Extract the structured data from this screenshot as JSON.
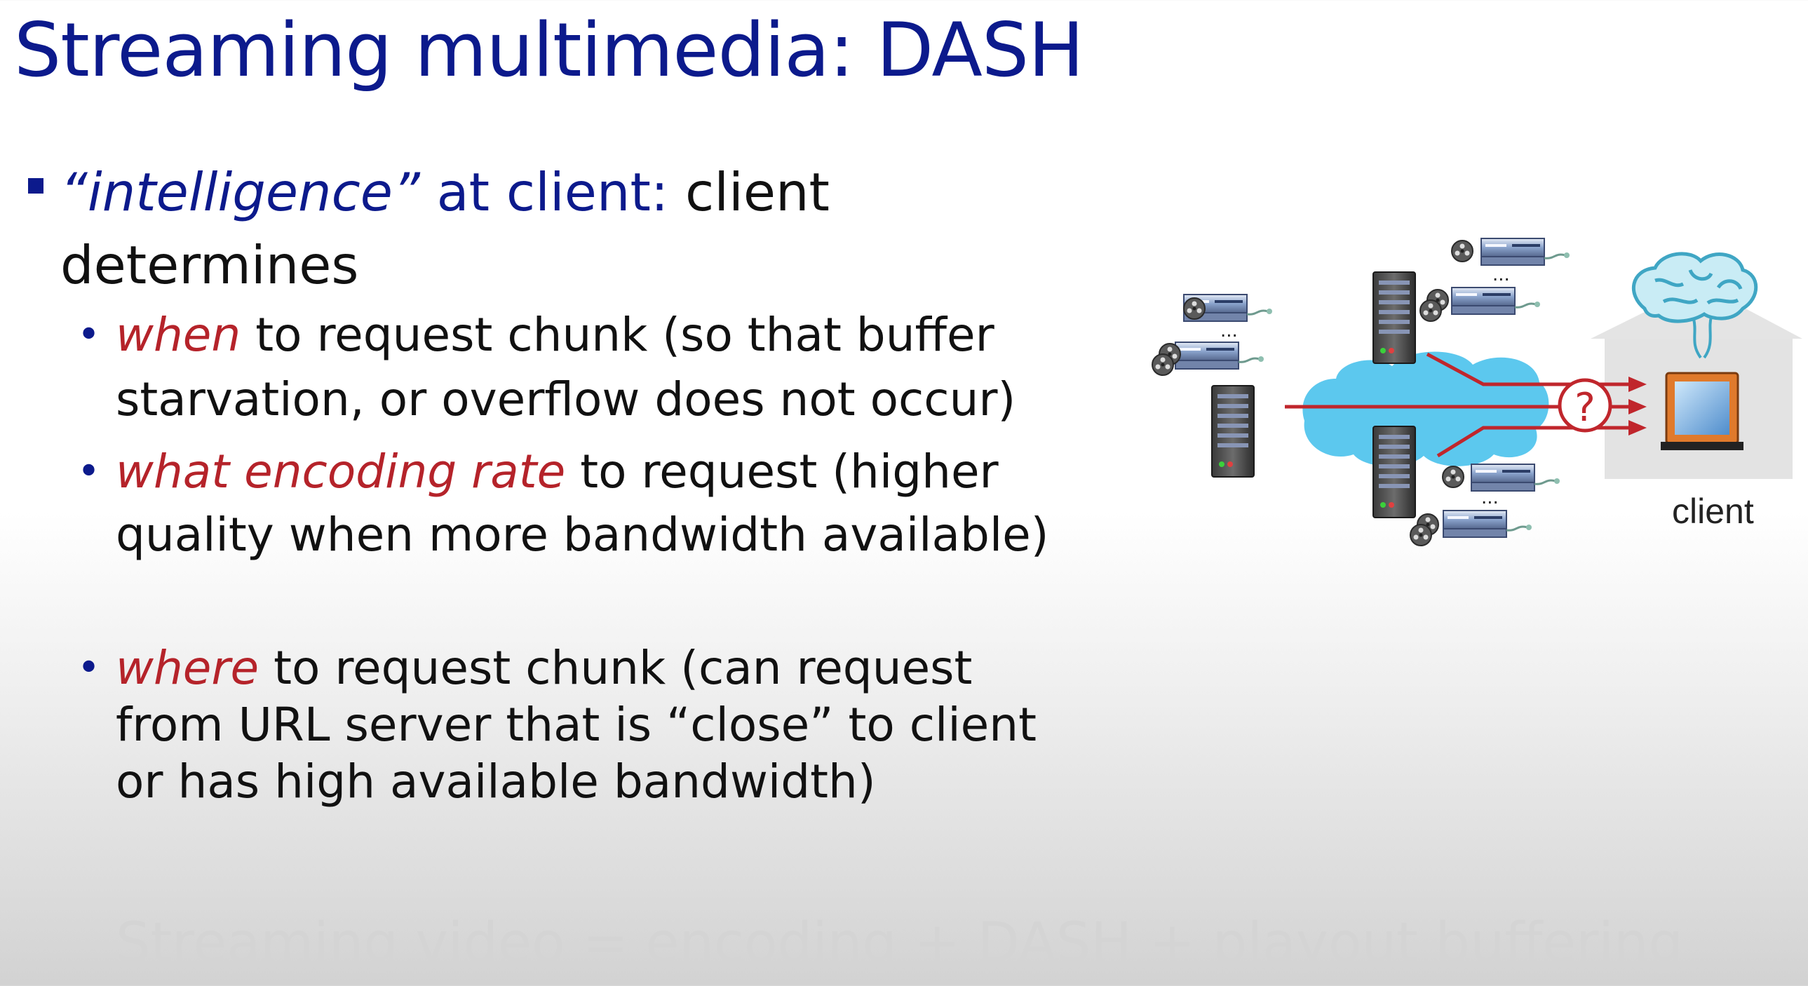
{
  "slide": {
    "title": "Streaming multimedia: DASH",
    "bullet": {
      "intelligence": "“intelligence”",
      "at_client": " at client:",
      "rest": " client determines"
    },
    "sub_bullets": [
      {
        "keyword": "when",
        "text": " to request chunk (so that buffer starvation, or overflow does not occur)"
      },
      {
        "keyword": "what encoding rate",
        "text": " to request (higher quality when more bandwidth available)"
      },
      {
        "keyword": "where",
        "text": " to request chunk (can request from URL server that is “close” to client or has high available bandwidth)"
      }
    ],
    "footer": "Streaming video = encoding + DASH + playout buffering"
  },
  "diagram": {
    "client_label": "client",
    "question_mark": "?",
    "ellipsis": "...",
    "colors": {
      "network_cloud": "#5cc8ee",
      "arrow": "#c0262c",
      "house": "#e3e3e3",
      "brain": "#6fc6dd"
    },
    "icons": [
      "server-tower-icon",
      "server-rack-icon",
      "film-reel-icon",
      "network-cloud-icon",
      "house-icon",
      "computer-monitor-icon",
      "brain-icon",
      "question-mark-icon"
    ]
  }
}
